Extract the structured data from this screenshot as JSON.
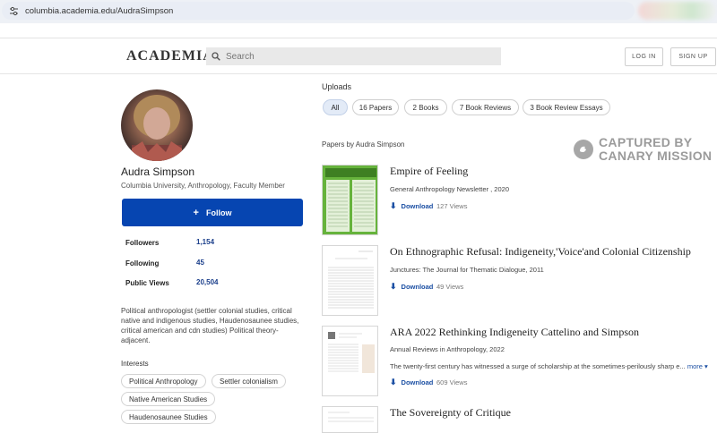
{
  "browser": {
    "url": "columbia.academia.edu/AudraSimpson"
  },
  "header": {
    "logo": "ACADEMIA",
    "search_placeholder": "Search",
    "login": "LOG IN",
    "signup": "SIGN UP"
  },
  "profile": {
    "name": "Audra Simpson",
    "affiliation": "Columbia University, Anthropology, Faculty Member",
    "follow_label": "Follow",
    "stats": [
      {
        "label": "Followers",
        "value": "1,154"
      },
      {
        "label": "Following",
        "value": "45"
      },
      {
        "label": "Public Views",
        "value": "20,504"
      }
    ],
    "bio": "Political anthropologist (settler colonial studies, critical native and indigenous studies, Haudenosaunee studies, critical american and cdn studies) Political theory-adjacent.",
    "interests_title": "Interests",
    "interests": [
      "Political Anthropology",
      "Settler colonialism",
      "Native American Studies",
      "Haudenosaunee Studies"
    ]
  },
  "uploads": {
    "title": "Uploads",
    "tabs": [
      "All",
      "16 Papers",
      "2 Books",
      "7 Book Reviews",
      "3 Book Review Essays"
    ],
    "active_tab": "All",
    "papers_by": "Papers by Audra Simpson"
  },
  "watermark": {
    "line1": "CAPTURED BY",
    "line2": "CANARY MISSION"
  },
  "papers": [
    {
      "title": "Empire of Feeling",
      "meta": "General Anthropology Newsletter , 2020",
      "download": "Download",
      "views": "127 Views",
      "thumb_label": "General Anthropology"
    },
    {
      "title": "On Ethnographic Refusal: Indigeneity,'Voice'and Colonial Citizenship",
      "meta": "Junctures: The Journal for Thematic Dialogue, 2011",
      "download": "Download",
      "views": "49 Views"
    },
    {
      "title": "ARA 2022 Rethinking Indigeneity Cattelino and Simpson",
      "meta": "Annual Reviews in Anthropology, 2022",
      "abstract": "The twenty-first century has witnessed a surge of scholarship at the sometimes-perilously sharp e...",
      "more": "more",
      "download": "Download",
      "views": "609 Views"
    },
    {
      "title": "The Sovereignty of Critique"
    }
  ]
}
